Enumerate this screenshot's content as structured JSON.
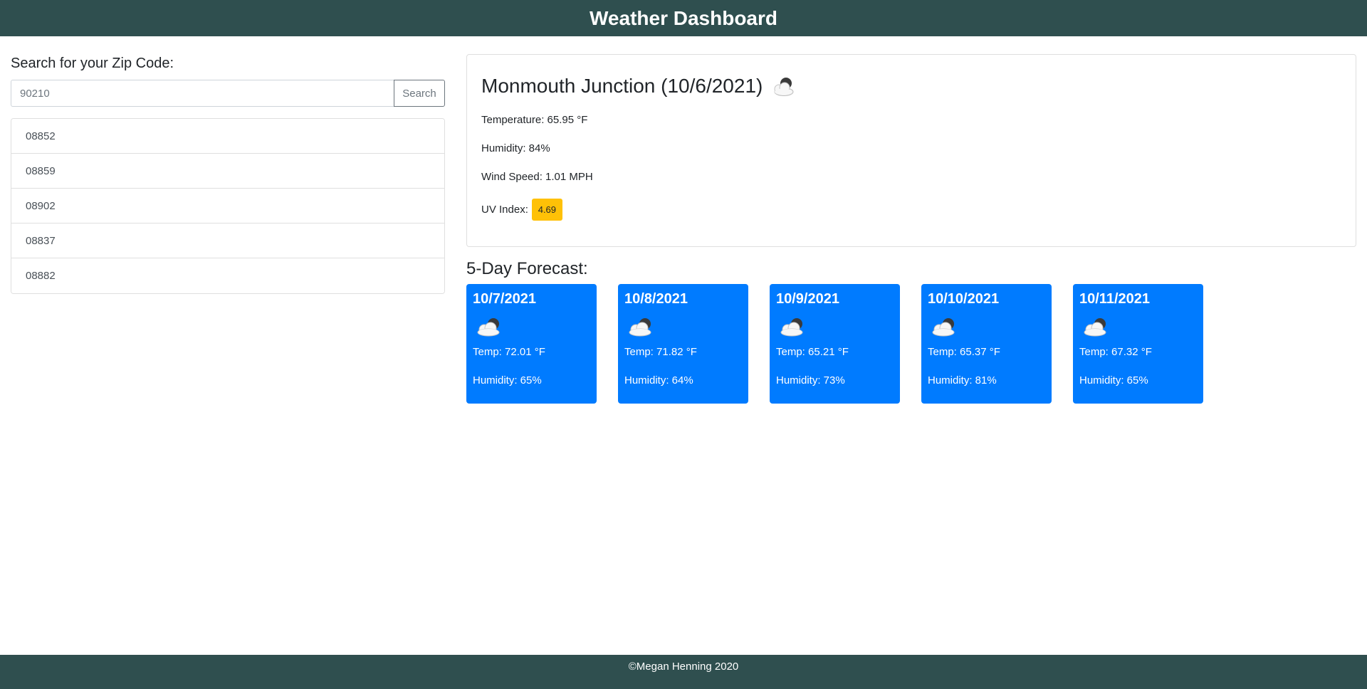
{
  "header": {
    "title": "Weather Dashboard"
  },
  "search": {
    "label": "Search for your Zip Code:",
    "placeholder": "90210",
    "button_label": "Search"
  },
  "history": [
    "08852",
    "08859",
    "08902",
    "08837",
    "08882"
  ],
  "current": {
    "city_title": "Monmouth Junction (10/6/2021)",
    "icon": "cloud-sun-icon",
    "temperature": "Temperature: 65.95 °F",
    "humidity": "Humidity: 84%",
    "wind": "Wind Speed: 1.01 MPH",
    "uv_label": "UV Index:",
    "uv_value": "4.69",
    "uv_color": "#ffc107"
  },
  "forecast": {
    "title": "5-Day Forecast:",
    "days": [
      {
        "date": "10/7/2021",
        "icon": "cloud-sun-icon",
        "temp": "Temp: 72.01 °F",
        "humidity": "Humidity: 65%"
      },
      {
        "date": "10/8/2021",
        "icon": "cloud-sun-icon",
        "temp": "Temp: 71.82 °F",
        "humidity": "Humidity: 64%"
      },
      {
        "date": "10/9/2021",
        "icon": "cloud-sun-icon",
        "temp": "Temp: 65.21 °F",
        "humidity": "Humidity: 73%"
      },
      {
        "date": "10/10/2021",
        "icon": "cloud-sun-icon",
        "temp": "Temp: 65.37 °F",
        "humidity": "Humidity: 81%"
      },
      {
        "date": "10/11/2021",
        "icon": "cloud-sun-icon",
        "temp": "Temp: 67.32 °F",
        "humidity": "Humidity: 65%"
      }
    ]
  },
  "footer": {
    "text": "©Megan Henning 2020"
  },
  "colors": {
    "header_bg": "#2f4f4f",
    "card_bg": "#007bff",
    "uv_badge": "#ffc107"
  }
}
